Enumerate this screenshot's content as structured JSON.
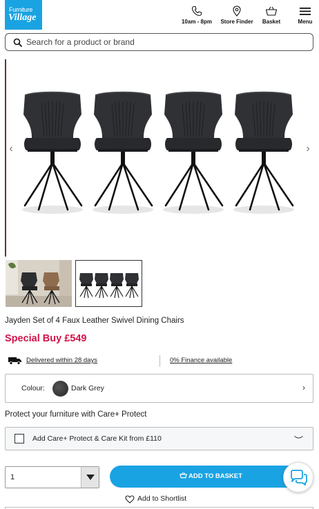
{
  "header": {
    "logo_line1": "Furniture",
    "logo_line2": "Village",
    "nav": {
      "hours": "10am - 8pm",
      "store_finder": "Store Finder",
      "basket": "Basket",
      "menu": "Menu"
    }
  },
  "search": {
    "placeholder": "Search for a product or brand"
  },
  "gallery": {
    "prev_icon": "chevron-left-icon",
    "next_icon": "chevron-right-icon",
    "thumbnail_count": 2,
    "selected_thumbnail": 2
  },
  "product": {
    "title": "Jayden Set of 4 Faux Leather Swivel Dining Chairs",
    "price": "Special Buy £549",
    "delivery": "Delivered within 28 days",
    "finance": "0% Finance available",
    "colour_label": "Colour:",
    "colour_value": "Dark Grey"
  },
  "protect": {
    "heading": "Protect your furniture with Care+ Protect",
    "option": "Add Care+ Protect & Care Kit from £110",
    "checked": false
  },
  "purchase": {
    "quantity": "1",
    "add_to_basket": "ADD TO BASKET",
    "shortlist": "Add to Shortlist"
  },
  "colors": {
    "brand_blue": "#1aa3e2",
    "price_red": "#d0154a",
    "swatch_dark_grey": "#333333"
  }
}
